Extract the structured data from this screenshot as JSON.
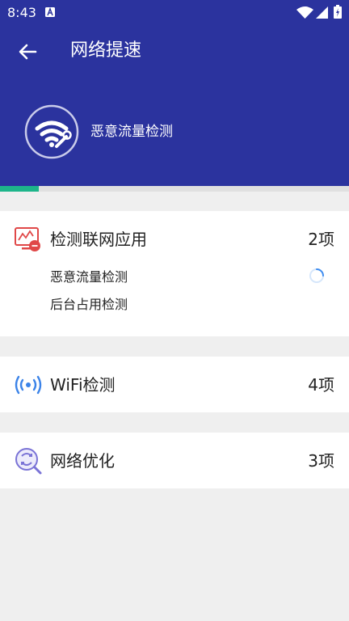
{
  "status_bar": {
    "time": "8:43",
    "notification_icon": "a-badge-icon",
    "icons": [
      "wifi-icon",
      "cell-signal-icon",
      "battery-charging-icon"
    ]
  },
  "header": {
    "title": "网络提速",
    "back_icon": "arrow-left-icon",
    "scan_icon": "wifi-wrench-icon",
    "scan_status": "恶意流量检测"
  },
  "progress": {
    "value_percent": 11,
    "color": "#1db58a"
  },
  "colors": {
    "header_bg": "#2b339e",
    "page_bg": "#efefef",
    "accent_green": "#1db58a"
  },
  "sections": [
    {
      "icon": "monitor-alert-icon",
      "label": "检测联网应用",
      "count": "2项",
      "items": [
        "恶意流量检测",
        "后台占用检测"
      ],
      "loading_icon": "loading-spinner-icon"
    },
    {
      "icon": "wifi-signal-icon",
      "label": "WiFi检测",
      "count": "4项"
    },
    {
      "icon": "network-optimize-icon",
      "label": "网络优化",
      "count": "3项"
    }
  ]
}
